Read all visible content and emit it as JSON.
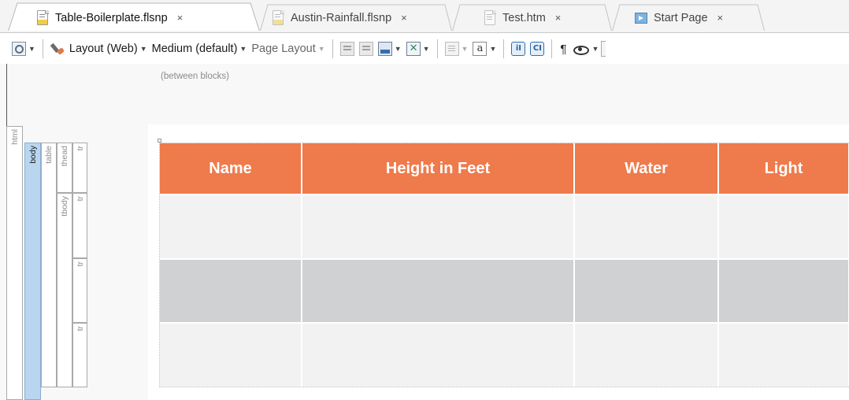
{
  "tabs": [
    {
      "label": "Table-Boilerplate.flsnp",
      "close": "×",
      "active": true
    },
    {
      "label": "Austin-Rainfall.flsnp",
      "close": "×",
      "active": false
    },
    {
      "label": "Test.htm",
      "close": "×",
      "active": false
    },
    {
      "label": "Start Page",
      "close": "×",
      "active": false
    }
  ],
  "toolbar": {
    "layout_label": "Layout (Web)",
    "medium_label": "Medium (default)",
    "page_layout_label": "Page Layout",
    "tag_i_label": "iI",
    "tag_c_label": "CI",
    "a_label": "a",
    "pilcrow": "¶"
  },
  "editor": {
    "hint": "(between blocks)"
  },
  "structure_bars": {
    "html": "html",
    "body": "body",
    "table": "table",
    "thead": "thead",
    "tbody": "tbody",
    "tr": "tr"
  },
  "table": {
    "headers": [
      "Name",
      "Height in Feet",
      "Water",
      "Light"
    ],
    "rows": [
      [
        "",
        "",
        "",
        ""
      ],
      [
        "",
        "",
        "",
        ""
      ],
      [
        "",
        "",
        "",
        ""
      ]
    ]
  },
  "colors": {
    "header": "#ef7a4b",
    "row_light": "#f2f2f2",
    "row_dark": "#cfd1d3",
    "body_bar": "#b9d5ef"
  }
}
